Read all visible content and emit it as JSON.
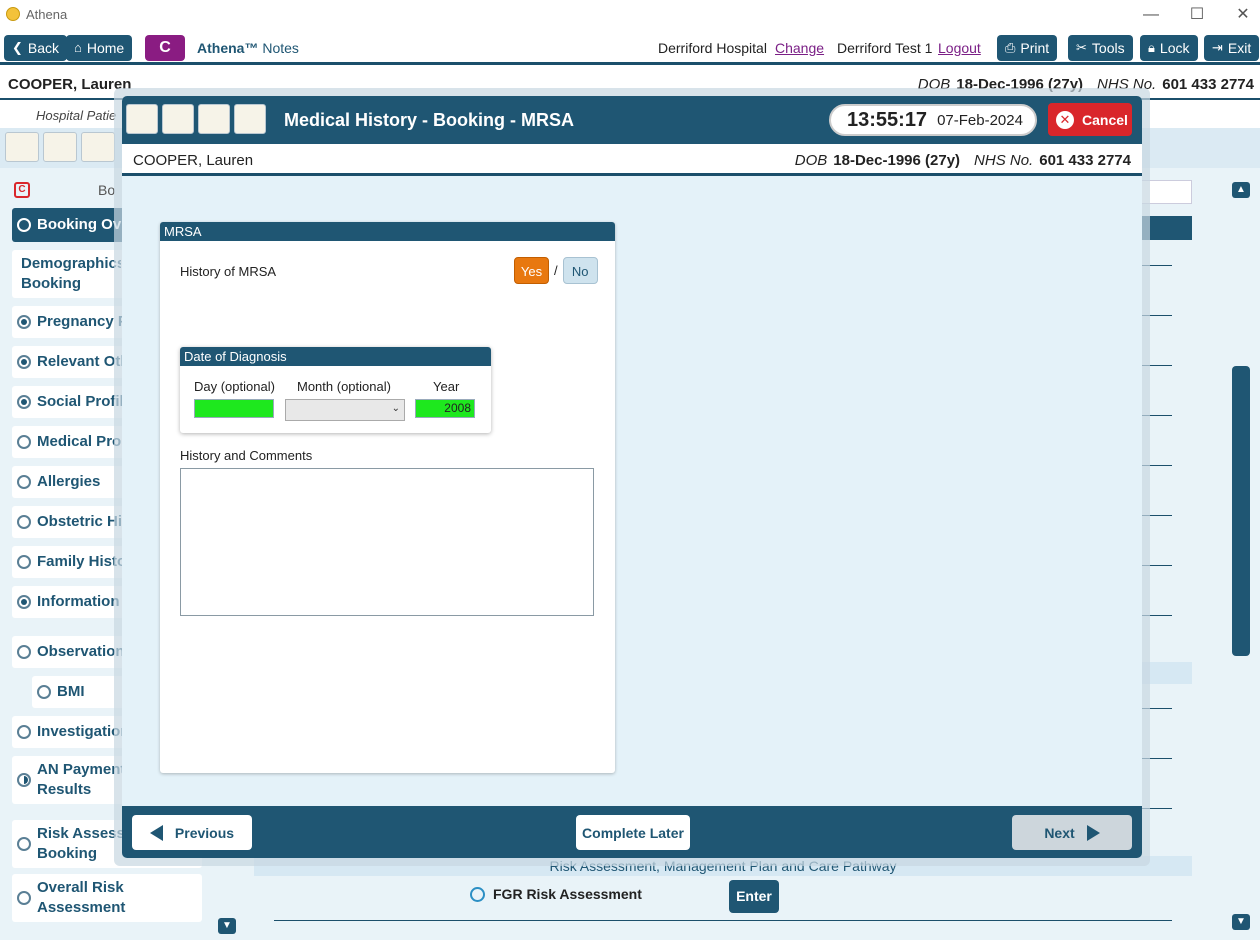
{
  "window": {
    "title": "Athena",
    "minimize": "—",
    "maximize": "☐",
    "close": "✕"
  },
  "toolbar": {
    "back": "Back",
    "home": "Home",
    "c_label": "C",
    "athena": "Athena™",
    "notes": "Notes",
    "hospital": "Derriford Hospital",
    "change": "Change",
    "user": "Derriford Test 1",
    "logout": "Logout",
    "print": "Print",
    "tools": "Tools",
    "lock": "Lock",
    "exit": "Exit"
  },
  "patient": {
    "name": "COOPER, Lauren",
    "dob_label": "DOB",
    "dob": "18-Dec-1996 (27y)",
    "nhs_label": "NHS No.",
    "nhs": "601 433 2774"
  },
  "background": {
    "hospital_patient": "Hospital Patie",
    "booking_header": "Bo",
    "sidebar": [
      {
        "label": "Booking Ov",
        "state": "empty",
        "active": true
      },
      {
        "label": "Demographics Booking",
        "state": "none"
      },
      {
        "label": "Pregnancy P",
        "state": "filled"
      },
      {
        "label": "Relevant Oth",
        "state": "filled"
      },
      {
        "label": "Social Profile",
        "state": "filled"
      },
      {
        "label": "Medical Pro",
        "state": "empty"
      },
      {
        "label": "Allergies",
        "state": "empty"
      },
      {
        "label": "Obstetric Hi",
        "state": "empty"
      },
      {
        "label": "Family Histo",
        "state": "empty"
      },
      {
        "label": "Information",
        "state": "filled"
      },
      {
        "label": "Observation",
        "state": "empty"
      },
      {
        "label": "BMI",
        "state": "empty"
      },
      {
        "label": "Investigation",
        "state": "empty"
      },
      {
        "label": "AN Payment Results",
        "state": "half"
      },
      {
        "label": "Risk Assess Booking",
        "state": "empty"
      },
      {
        "label": "Overall Risk Assessment",
        "state": "empty"
      }
    ],
    "risk_band": "Risk Assessment, Management Plan and Care Pathway",
    "fgr": "FGR Risk Assessment",
    "enter": "Enter"
  },
  "modal": {
    "title": "Medical History - Booking - MRSA",
    "time": "13:55:17",
    "date": "07-Feb-2024",
    "cancel": "Cancel",
    "panel_title": "MRSA",
    "question": "History of MRSA",
    "yes": "Yes",
    "no": "No",
    "selected": "Yes",
    "date_of_diagnosis": {
      "title": "Date of Diagnosis",
      "day_label": "Day (optional)",
      "month_label": "Month (optional)",
      "year_label": "Year",
      "day_value": "",
      "month_value": "",
      "year_value": "2008"
    },
    "history_label": "History and Comments",
    "history_value": "",
    "previous": "Previous",
    "complete_later": "Complete Later",
    "next": "Next"
  },
  "colors": {
    "primary": "#1f5673",
    "accent_yes": "#e8780f",
    "field_valid": "#1ee81e",
    "cancel": "#d9262b",
    "c_button": "#8a1c82"
  }
}
